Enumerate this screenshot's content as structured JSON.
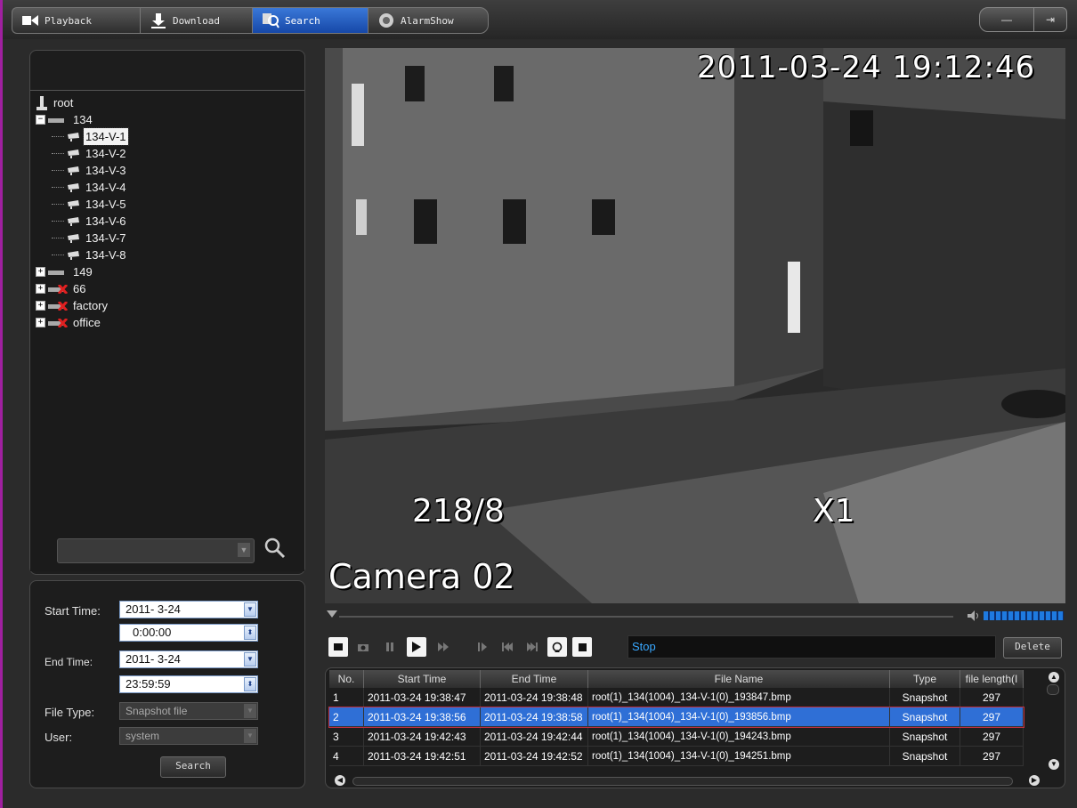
{
  "tabs": [
    {
      "label": "Playback",
      "icon": "playback-icon",
      "active": false
    },
    {
      "label": "Download",
      "icon": "download-icon",
      "active": false
    },
    {
      "label": "Search",
      "icon": "search-tab-icon",
      "active": true
    },
    {
      "label": "AlarmShow",
      "icon": "alarm-icon",
      "active": false
    }
  ],
  "window_controls": {
    "minimize": "—",
    "exit": "⇥"
  },
  "tree": {
    "root": "root",
    "nodes": [
      {
        "label": "134",
        "expanded": true,
        "online": true,
        "children": [
          "134-V-1",
          "134-V-2",
          "134-V-3",
          "134-V-4",
          "134-V-5",
          "134-V-6",
          "134-V-7",
          "134-V-8"
        ]
      },
      {
        "label": "149",
        "expanded": false,
        "online": true
      },
      {
        "label": "66",
        "expanded": false,
        "online": false
      },
      {
        "label": "factory",
        "expanded": false,
        "online": false
      },
      {
        "label": "office",
        "expanded": false,
        "online": false
      }
    ],
    "selected": "134-V-1"
  },
  "query": {
    "start_time_label": "Start Time:",
    "start_date": "2011- 3-24",
    "start_clock": "0:00:00",
    "end_time_label": "End Time:",
    "end_date": "2011- 3-24",
    "end_clock": "23:59:59",
    "file_type_label": "File Type:",
    "file_type": "Snapshot file",
    "user_label": "User:",
    "user": "system",
    "search_button": "Search"
  },
  "video": {
    "timestamp": "2011-03-24 19:12:46",
    "counter": "218/8",
    "speed": "X1",
    "camera": "Camera 02"
  },
  "player": {
    "status": "Stop",
    "delete_button": "Delete"
  },
  "files_table": {
    "columns": [
      "No.",
      "Start Time",
      "End Time",
      "File Name",
      "Type",
      "file length(I"
    ],
    "rows": [
      [
        "1",
        "2011-03-24 19:38:47",
        "2011-03-24 19:38:48",
        "root(1)_134(1004)_134-V-1(0)_193847.bmp",
        "Snapshot",
        "297"
      ],
      [
        "2",
        "2011-03-24 19:38:56",
        "2011-03-24 19:38:58",
        "root(1)_134(1004)_134-V-1(0)_193856.bmp",
        "Snapshot",
        "297"
      ],
      [
        "3",
        "2011-03-24 19:42:43",
        "2011-03-24 19:42:44",
        "root(1)_134(1004)_134-V-1(0)_194243.bmp",
        "Snapshot",
        "297"
      ],
      [
        "4",
        "2011-03-24 19:42:51",
        "2011-03-24 19:42:52",
        "root(1)_134(1004)_134-V-1(0)_194251.bmp",
        "Snapshot",
        "297"
      ]
    ],
    "selected_row": 1
  },
  "colors": {
    "accent": "#2f6fd6",
    "status_text": "#39a8ff",
    "offline": "#e02020"
  }
}
